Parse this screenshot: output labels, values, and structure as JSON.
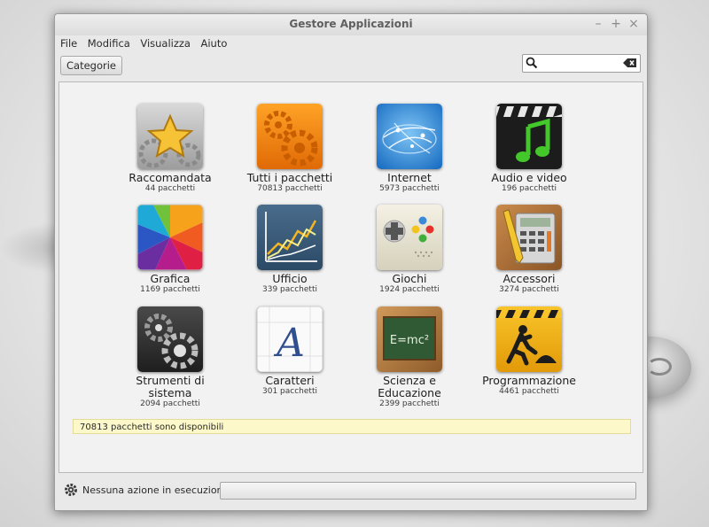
{
  "window": {
    "title": "Gestore Applicazioni"
  },
  "window_controls": {
    "minimize": "–",
    "maximize": "+",
    "close": "×"
  },
  "menubar": {
    "items": [
      "File",
      "Modifica",
      "Visualizza",
      "Aiuto"
    ]
  },
  "toolbar": {
    "categories_label": "Categorie"
  },
  "search": {
    "placeholder": "",
    "value": ""
  },
  "categories": [
    {
      "name": "Raccomandata",
      "count": "44 pacchetti",
      "icon": "star-gears-icon"
    },
    {
      "name": "Tutti i pacchetti",
      "count": "70813 pacchetti",
      "icon": "orange-gears-icon"
    },
    {
      "name": "Internet",
      "count": "5973 pacchetti",
      "icon": "globe-network-icon"
    },
    {
      "name": "Audio e video",
      "count": "196 pacchetti",
      "icon": "clapperboard-music-icon"
    },
    {
      "name": "Grafica",
      "count": "1169 pacchetti",
      "icon": "color-wheel-icon"
    },
    {
      "name": "Ufficio",
      "count": "339 pacchetti",
      "icon": "line-chart-icon"
    },
    {
      "name": "Giochi",
      "count": "1924 pacchetti",
      "icon": "gamepad-icon"
    },
    {
      "name": "Accessori",
      "count": "3274 pacchetti",
      "icon": "calculator-pencil-icon"
    },
    {
      "name": "Strumenti di\nsistema",
      "count": "2094 pacchetti",
      "icon": "dark-gears-icon"
    },
    {
      "name": "Caratteri",
      "count": "301 pacchetti",
      "icon": "letter-a-icon"
    },
    {
      "name": "Scienza e\nEducazione",
      "count": "2399 pacchetti",
      "icon": "chalkboard-icon"
    },
    {
      "name": "Programmazione",
      "count": "4461 pacchetti",
      "icon": "construction-worker-icon"
    }
  ],
  "info": {
    "text": "70813 pacchetti sono disponibili"
  },
  "status": {
    "text": "Nessuna azione in esecuzione"
  },
  "colors": {
    "info_bar_bg": "#fcf8c9",
    "window_bg": "#e9e9e9",
    "content_bg": "#f2f2f2"
  }
}
